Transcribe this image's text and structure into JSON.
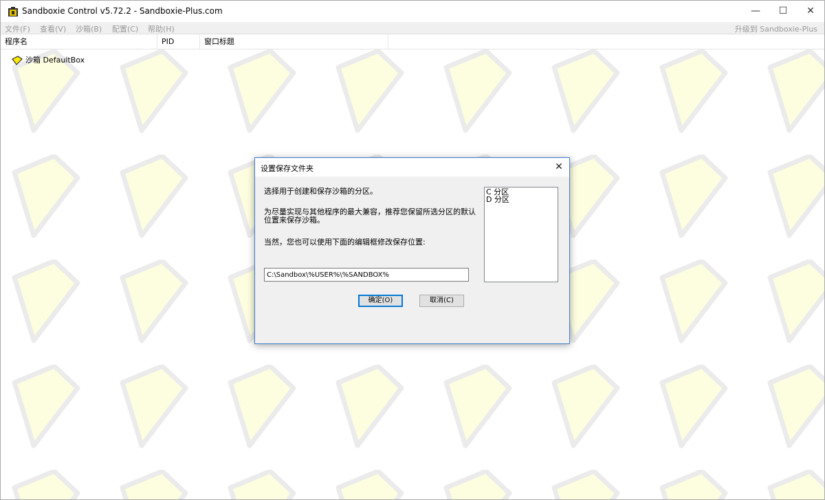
{
  "window": {
    "title": "Sandboxie Control v5.72.2 - Sandboxie-Plus.com",
    "minimize": "—",
    "maximize": "☐",
    "close": "✕"
  },
  "menu": {
    "items": [
      "文件(F)",
      "查看(V)",
      "沙箱(B)",
      "配置(C)",
      "帮助(H)"
    ],
    "upgrade": "升级到 Sandboxie-Plus"
  },
  "columns": [
    "程序名",
    "PID",
    "窗口标题"
  ],
  "tree": {
    "sandbox": "沙箱 DefaultBox"
  },
  "dialog": {
    "title": "设置保存文件夹",
    "close": "✕",
    "line1": "选择用于创建和保存沙箱的分区。",
    "line2a": "为尽量实现与其他程序的最大兼容，推荐您保留所选分区的默认",
    "line2b": "位置来保存沙箱。",
    "line3": "当然，您也可以使用下面的编辑框修改保存位置:",
    "path_value": "C:\\Sandbox\\%USER%\\%SANDBOX%",
    "drives": [
      "C 分区",
      "D 分区"
    ],
    "ok": "确定(O)",
    "cancel": "取消(C)"
  },
  "colors": {
    "pattern_fill": "#fdfde0",
    "pattern_stroke": "#ebebeb",
    "dialog_border": "#3f7dc8",
    "sandbox_icon": "#ffea00"
  }
}
